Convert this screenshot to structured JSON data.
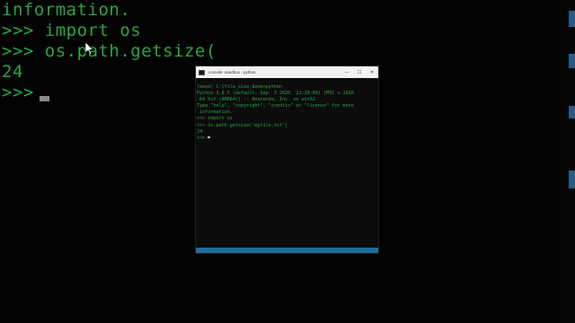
{
  "background_console": {
    "lines": [
      "information.",
      ">>> import os",
      ">>> os.path.getsize(",
      "24",
      ">>>"
    ]
  },
  "window": {
    "title": "console: sandbox - python",
    "minimize_glyph": "—",
    "maximize_glyph": "☐",
    "close_glyph": "✕",
    "lines": [
      "(base) C:\\file_size_demo>python",
      "Python 3.8.5 (default, Sep  3 2020, 21:29:08) [MSC v.1916",
      " 64 bit (AMD64)] :: Anaconda, Inc. on win32",
      "Type \"help\", \"copyright\", \"credits\" or \"license\" for more",
      " information.",
      ">>> import os",
      ">>> os.path.getsize('myfile.txt')",
      "24",
      ">>> "
    ]
  },
  "colors": {
    "console_text": "#2aa640",
    "console_bg": "#0c0c0c",
    "titlebar_bg": "#f2f2f2",
    "accent": "#1f6f9a"
  },
  "icons": {
    "pointer": "mouse-pointer-icon",
    "app": "console-app-icon"
  }
}
